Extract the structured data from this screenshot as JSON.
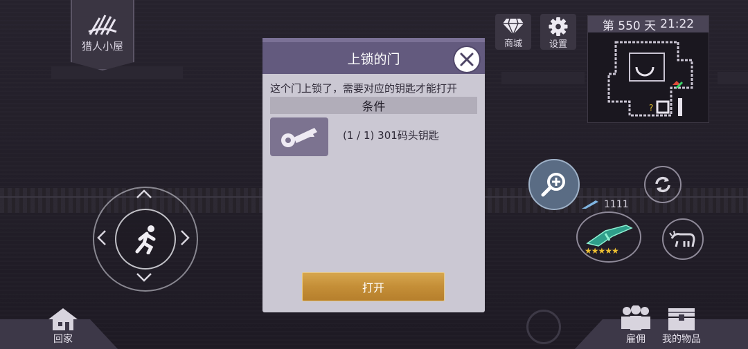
{
  "hud": {
    "hut_label": "猎人小屋",
    "shop_label": "商城",
    "settings_label": "设置",
    "day_text": "第 550 天",
    "time_text": "21:22",
    "ammo_count": "1111",
    "weapon_stars": 5,
    "home_label": "回家",
    "hire_label": "雇佣",
    "items_label": "我的物品"
  },
  "modal": {
    "title": "上锁的门",
    "description": "这个门上锁了，需要对应的钥匙才能打开",
    "conditions_header": "条件",
    "requirement": {
      "icon": "key-icon",
      "text": "(1 / 1) 301码头钥匙"
    },
    "open_button": "打开"
  },
  "colors": {
    "modal_header": "#635a7e",
    "modal_body": "#cbc8d3",
    "open_button": "#c48e37",
    "zoom_button": "#5a6c84"
  }
}
